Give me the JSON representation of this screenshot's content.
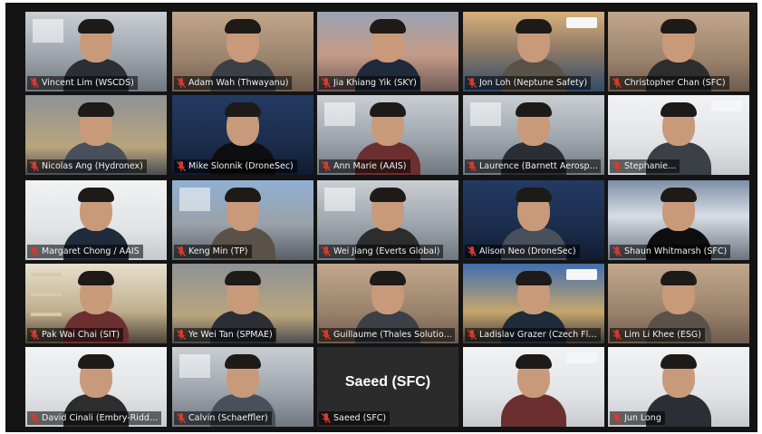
{
  "meeting": {
    "participants": [
      {
        "name": "Vincent Lim (WSCDS)",
        "style": "office",
        "camera": true,
        "audio": "muted"
      },
      {
        "name": "Adam Wah (Thwayanu)",
        "style": "warm",
        "camera": true,
        "audio": "muted"
      },
      {
        "name": "Jia Khiang Yik (SKY)",
        "style": "sunset",
        "camera": true,
        "audio": "muted"
      },
      {
        "name": "Jon Loh (Neptune Safety)",
        "style": "offshore",
        "camera": true,
        "audio": "muted",
        "logo": true
      },
      {
        "name": "Christopher Chan (SFC)",
        "style": "warm",
        "camera": true,
        "audio": "muted"
      },
      {
        "name": "Nicolas Ang (Hydronex)",
        "style": "warehouse",
        "camera": true,
        "audio": "muted"
      },
      {
        "name": "Mike Slonnik (DroneSec)",
        "style": "dark-blue",
        "camera": true,
        "audio": "muted"
      },
      {
        "name": "Ann Marie (AAIS)",
        "style": "office",
        "camera": true,
        "audio": "muted"
      },
      {
        "name": "Laurence (Barnett Aerosp…",
        "style": "office",
        "camera": true,
        "audio": "muted"
      },
      {
        "name": "Stephanie…",
        "style": "white",
        "camera": true,
        "audio": "muted",
        "logo": true
      },
      {
        "name": "Margaret Chong / AAIS",
        "style": "white",
        "camera": true,
        "audio": "muted"
      },
      {
        "name": "Keng Min (TP)",
        "style": "building",
        "camera": true,
        "audio": "muted"
      },
      {
        "name": "Wei Jiang (Everts Global)",
        "style": "office",
        "camera": true,
        "audio": "muted"
      },
      {
        "name": "Alison Neo (DroneSec)",
        "style": "dark-blue",
        "camera": true,
        "audio": "muted"
      },
      {
        "name": "Shaun Whitmarsh (SFC)",
        "style": "mountain",
        "camera": true,
        "audio": "muted"
      },
      {
        "name": "Pak Wai Chai (SIT)",
        "style": "bookshelf",
        "camera": true,
        "audio": "muted"
      },
      {
        "name": "Ye Wei Tan (SPMAE)",
        "style": "warehouse",
        "camera": true,
        "audio": "muted"
      },
      {
        "name": "Guillaume (Thales Solutio…",
        "style": "warm",
        "camera": true,
        "audio": "muted"
      },
      {
        "name": "Ladislav Grazer (Czech Fl…",
        "style": "city",
        "camera": true,
        "audio": "muted",
        "logo": true
      },
      {
        "name": "Lim Li Khee (ESG)",
        "style": "warm",
        "camera": true,
        "audio": "muted"
      },
      {
        "name": "David Cinali (Embry-Ridd…",
        "style": "white",
        "camera": true,
        "audio": "muted"
      },
      {
        "name": "Calvin (Schaeffler)",
        "style": "office",
        "camera": true,
        "audio": "muted"
      },
      {
        "name": "Saeed (SFC)",
        "style": "none",
        "camera": false,
        "audio": "muted"
      },
      {
        "name": "",
        "style": "white",
        "camera": true,
        "audio": "none",
        "logo": true
      },
      {
        "name": "Jun Long",
        "style": "white",
        "camera": true,
        "audio": "muted"
      }
    ],
    "colors": {
      "background": "#141414",
      "nameplate": "#000000",
      "mic_muted": "#d83a2e",
      "name_text": "#f2f2f2"
    }
  }
}
